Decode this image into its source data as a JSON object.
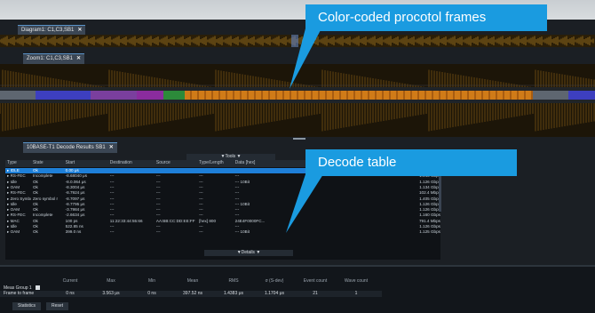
{
  "tabs": {
    "diagram": "Diagram1: C1,C3,SB1",
    "zoom": "Zoom1: C1,C3,SB1",
    "decode": "10BASE-T1 Decode Results SB1"
  },
  "callouts": {
    "frames": "Color-coded procotol frames",
    "table": "Decode table"
  },
  "table": {
    "tools_label": "▼Tools ▼",
    "details_label": "▼Details ▼",
    "headers": [
      "Type",
      "State",
      "Start",
      "Destination",
      "Source",
      "Type/Length",
      "Data [hex]",
      "",
      ""
    ],
    "rows": [
      [
        "IDLE",
        "Ok",
        "0.00 μs",
        "",
        "",
        "",
        "",
        "",
        "1.134 Gbps"
      ],
      [
        "RS-FEC",
        "Incomplete",
        "-8.68040 μs",
        "---",
        "---",
        "---",
        "---",
        "",
        "1.045 Gbps"
      ],
      [
        "Idle",
        "Ok",
        "-8.0.064 μs",
        "---",
        "---",
        "---",
        "--- 10Bit",
        "",
        "1.126 Gbps"
      ],
      [
        "OAM",
        "Ok",
        "-8.3004 μs",
        "---",
        "---",
        "---",
        "---",
        "",
        "1.134 Gbps"
      ],
      [
        "RS-FEC",
        "Ok",
        "-8.7924 μs",
        "---",
        "---",
        "---",
        "---",
        "",
        "102.4 Mbps"
      ],
      [
        "Zero Symbol",
        "Zero symbol r",
        "-8.7097 μs",
        "---",
        "---",
        "---",
        "---",
        "",
        "1.405 Gbps"
      ],
      [
        "Idle",
        "Ok",
        "-8.7795 μs",
        "---",
        "---",
        "---",
        "--- 10Bit",
        "",
        "1.126 Gbps"
      ],
      [
        "OAM",
        "Ok",
        "-3.7984 μs",
        "---",
        "---",
        "---",
        "---",
        "",
        "1.126 Gbps"
      ],
      [
        "RS-FEC",
        "Incomplete",
        "-2.6634 μs",
        "---",
        "---",
        "---",
        "---",
        "",
        "1.160 Gbps"
      ],
      [
        "MAC",
        "Ok",
        "100 ps",
        "11:22:33:44:55:66",
        "AA:BB:CC:DD:EE:FF",
        "[hex] 800",
        "24E4F0000FC...",
        "",
        "791.4 Mbps"
      ],
      [
        "Idle",
        "Ok",
        "522.85 ns",
        "---",
        "---",
        "---",
        "---",
        "",
        "1.126 Gbps"
      ],
      [
        "OAM",
        "Ok",
        "399.0 ns",
        "---",
        "---",
        "---",
        "--- 10Bit",
        "",
        "1.125 Gbps"
      ]
    ]
  },
  "measure": {
    "headers": [
      "Current",
      "Max",
      "Min",
      "Mean",
      "RMS",
      "σ (S-dev)",
      "Event count",
      "Wave count"
    ],
    "group_label": "Meas Group 1",
    "row_label": "Frame to frame",
    "values": [
      "0 ns",
      "3.563 μs",
      "0 ns",
      "397.52 ns",
      "1.4383 μs",
      "1.1704 μs",
      "21",
      "1"
    ]
  },
  "buttons": {
    "statistics": "Statistics",
    "reset": "Reset"
  },
  "colors": {
    "accent": "#1a9be0",
    "idle_frame": "#d07b18",
    "mac_frame": "#4a52c8",
    "oam_frame": "#8e3fa8",
    "fec_frame": "#2e8f3e"
  }
}
